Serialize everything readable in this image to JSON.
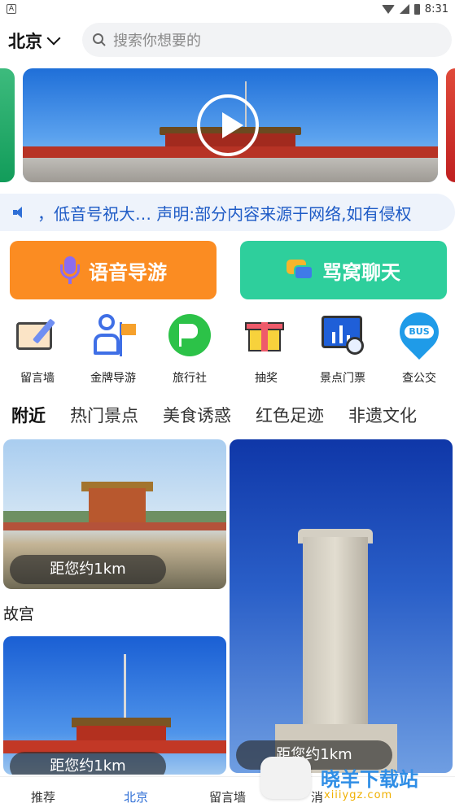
{
  "status_bar": {
    "time": "8:31",
    "left_icon": "A"
  },
  "header": {
    "city": "北京",
    "search_placeholder": "搜索你想要的"
  },
  "notice": {
    "text": "，低音号祝大… 声明:部分内容来源于网络,如有侵权"
  },
  "actions": {
    "voice_guide": "语音导游",
    "chat": "骂窝聊天"
  },
  "icon_grid": [
    {
      "label": "留言墙",
      "icon": "message-board-icon"
    },
    {
      "label": "金牌导游",
      "icon": "guide-icon"
    },
    {
      "label": "旅行社",
      "icon": "travel-agency-icon"
    },
    {
      "label": "抽奖",
      "icon": "lottery-icon"
    },
    {
      "label": "景点门票",
      "icon": "ticket-icon"
    },
    {
      "label": "查公交",
      "icon": "bus-icon",
      "badge": "BUS"
    }
  ],
  "tabs": [
    "附近",
    "热门景点",
    "美食诱惑",
    "红色足迹",
    "非遗文化"
  ],
  "cards": [
    {
      "distance": "距您约1km",
      "name": "故宫"
    },
    {
      "distance": "距您约1km"
    },
    {
      "distance": "距您约1km"
    }
  ],
  "bottom_nav": [
    "推荐",
    "北京",
    "留言墙",
    "消"
  ],
  "watermark": {
    "text": "晓羊下载站",
    "sub": "xiiiygz.com"
  },
  "colors": {
    "accent": "#2f6fd6",
    "voice_button": "#fb8c22",
    "chat_button": "#2ecf9c"
  }
}
